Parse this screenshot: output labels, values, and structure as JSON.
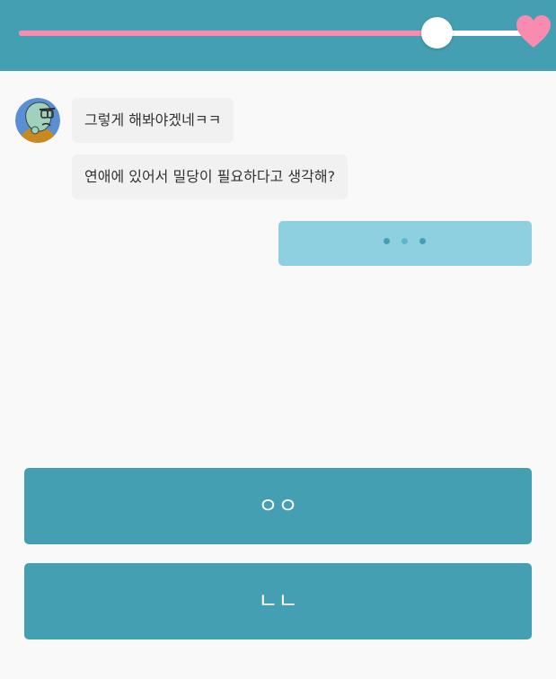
{
  "header": {
    "affection_level": 0.81,
    "colors": {
      "bar_background": "#439fb1",
      "fill": "#f98bb0",
      "heart": "#f98bb0"
    },
    "icon": "heart-icon"
  },
  "chat": {
    "avatar_icon": "character-avatar-icon",
    "messages": [
      {
        "text": "그렇게 해봐야겠네ㅋㅋ"
      },
      {
        "text": "연애에 있어서 밀당이 필요하다고 생각해?"
      }
    ],
    "typing_indicator": true
  },
  "answers": [
    {
      "label": "ㅇㅇ"
    },
    {
      "label": "ㄴㄴ"
    }
  ]
}
